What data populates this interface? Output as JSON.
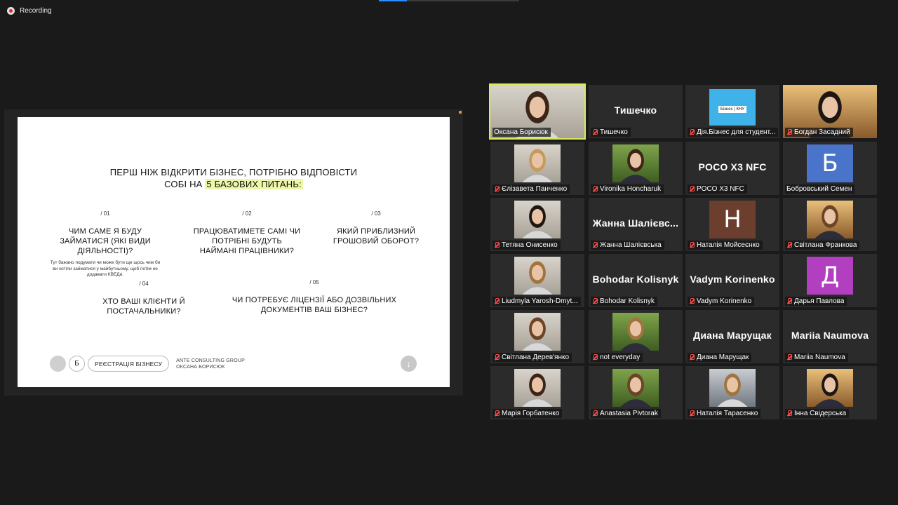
{
  "app": {
    "recording_label": "Recording"
  },
  "slide": {
    "title_line1": "ПЕРШ НІЖ ВІДКРИТИ БІЗНЕС, ПОТРІБНО ВІДПОВІСТИ",
    "title_line2_prefix": "СОБІ НА ",
    "title_highlight": "5 БАЗОВИХ ПИТАНЬ:",
    "questions": [
      {
        "num": "/ 01",
        "text": "ЧИМ САМЕ Я БУДУ ЗАЙМАТИСЯ (ЯКІ ВИДИ ДІЯЛЬНОСТІ)?",
        "note": "Тут бажано подумати чи може бути ще щось чим би ви хотіли займатися у майбутньому, щоб потім не додавати КВЕДи."
      },
      {
        "num": "/ 02",
        "text": "ПРАЦЮВАТИМЕТЕ САМІ ЧИ ПОТРІБНІ БУДУТЬ НАЙМАНІ ПРАЦІВНИКИ?"
      },
      {
        "num": "/ 03",
        "text": "ЯКИЙ ПРИБЛИЗНИЙ ГРОШОВИЙ ОБОРОТ?"
      },
      {
        "num": "/ 04",
        "text": "ХТО ВАШІ КЛІЄНТИ Й ПОСТАЧАЛЬНИКИ?"
      },
      {
        "num": "/ 05",
        "text": "ЧИ ПОТРЕБУЄ ЛІЦЕНЗІЇ АБО ДОЗВІЛЬНИХ ДОКУМЕНТІВ ВАШ БІЗНЕС?"
      }
    ],
    "footer": {
      "badge_letter": "Б",
      "pill_label": "РЕЄСТРАЦІЯ БІЗНЕСУ",
      "company_line1": "ANTE CONSULTING GROUP",
      "company_line2": "ОКСАНА БОРИСЮК",
      "down_arrow": "↓"
    }
  },
  "participants": [
    {
      "name": "Оксана Борисюк",
      "kind": "video",
      "active": true,
      "muted": false
    },
    {
      "name": "Тишечко",
      "kind": "name",
      "display": "Тишечко",
      "muted": true
    },
    {
      "name": "Дія.Бізнес для студент...",
      "kind": "logo",
      "logo_text": "Бізнес | КНУ",
      "muted": true
    },
    {
      "name": "Богдан Засадний",
      "kind": "video",
      "muted": true
    },
    {
      "name": "Єлізавета Панченко",
      "kind": "photo",
      "muted": true
    },
    {
      "name": "Vironika Honcharuk",
      "kind": "photo",
      "muted": true
    },
    {
      "name": "POCO X3 NFC",
      "kind": "name",
      "display": "POCO X3 NFC",
      "muted": true
    },
    {
      "name": "Бобровський Семен",
      "kind": "avatar",
      "letter": "Б",
      "color": "#4a74c9",
      "muted": false
    },
    {
      "name": "Тетяна Онисенко",
      "kind": "photo",
      "muted": true
    },
    {
      "name": "Жанна Шалієвська",
      "kind": "name",
      "display": "Жанна Шалієвс...",
      "muted": true
    },
    {
      "name": "Наталія Мойсеєнко",
      "kind": "avatar",
      "letter": "Н",
      "color": "#6b3e2e",
      "muted": true
    },
    {
      "name": "Світлана Франкова",
      "kind": "photo",
      "muted": true
    },
    {
      "name": "Liudmyla Yarosh-Dmyt...",
      "kind": "photo",
      "muted": true
    },
    {
      "name": "Bohodar Kolisnyk",
      "kind": "name",
      "display": "Bohodar Kolisnyk",
      "muted": true
    },
    {
      "name": "Vadym Korinenko",
      "kind": "name",
      "display": "Vadym Korinenko",
      "muted": true
    },
    {
      "name": "Дарья Павлова",
      "kind": "avatar",
      "letter": "Д",
      "color": "#b13fc0",
      "muted": true
    },
    {
      "name": "Світлана Дерев'янко",
      "kind": "photo",
      "muted": true
    },
    {
      "name": "not everyday",
      "kind": "photo",
      "muted": true
    },
    {
      "name": "Диана Марущак",
      "kind": "name",
      "display": "Диана Марущак",
      "muted": true
    },
    {
      "name": "Mariia Naumova",
      "kind": "name",
      "display": "Mariia Naumova",
      "muted": true
    },
    {
      "name": "Марія Горбатенко",
      "kind": "photo",
      "muted": true
    },
    {
      "name": "Anastasia Pivtorak",
      "kind": "photo",
      "muted": true
    },
    {
      "name": "Наталія Тарасенко",
      "kind": "photo",
      "muted": true
    },
    {
      "name": "Інна Свідерська",
      "kind": "photo",
      "muted": true
    }
  ]
}
